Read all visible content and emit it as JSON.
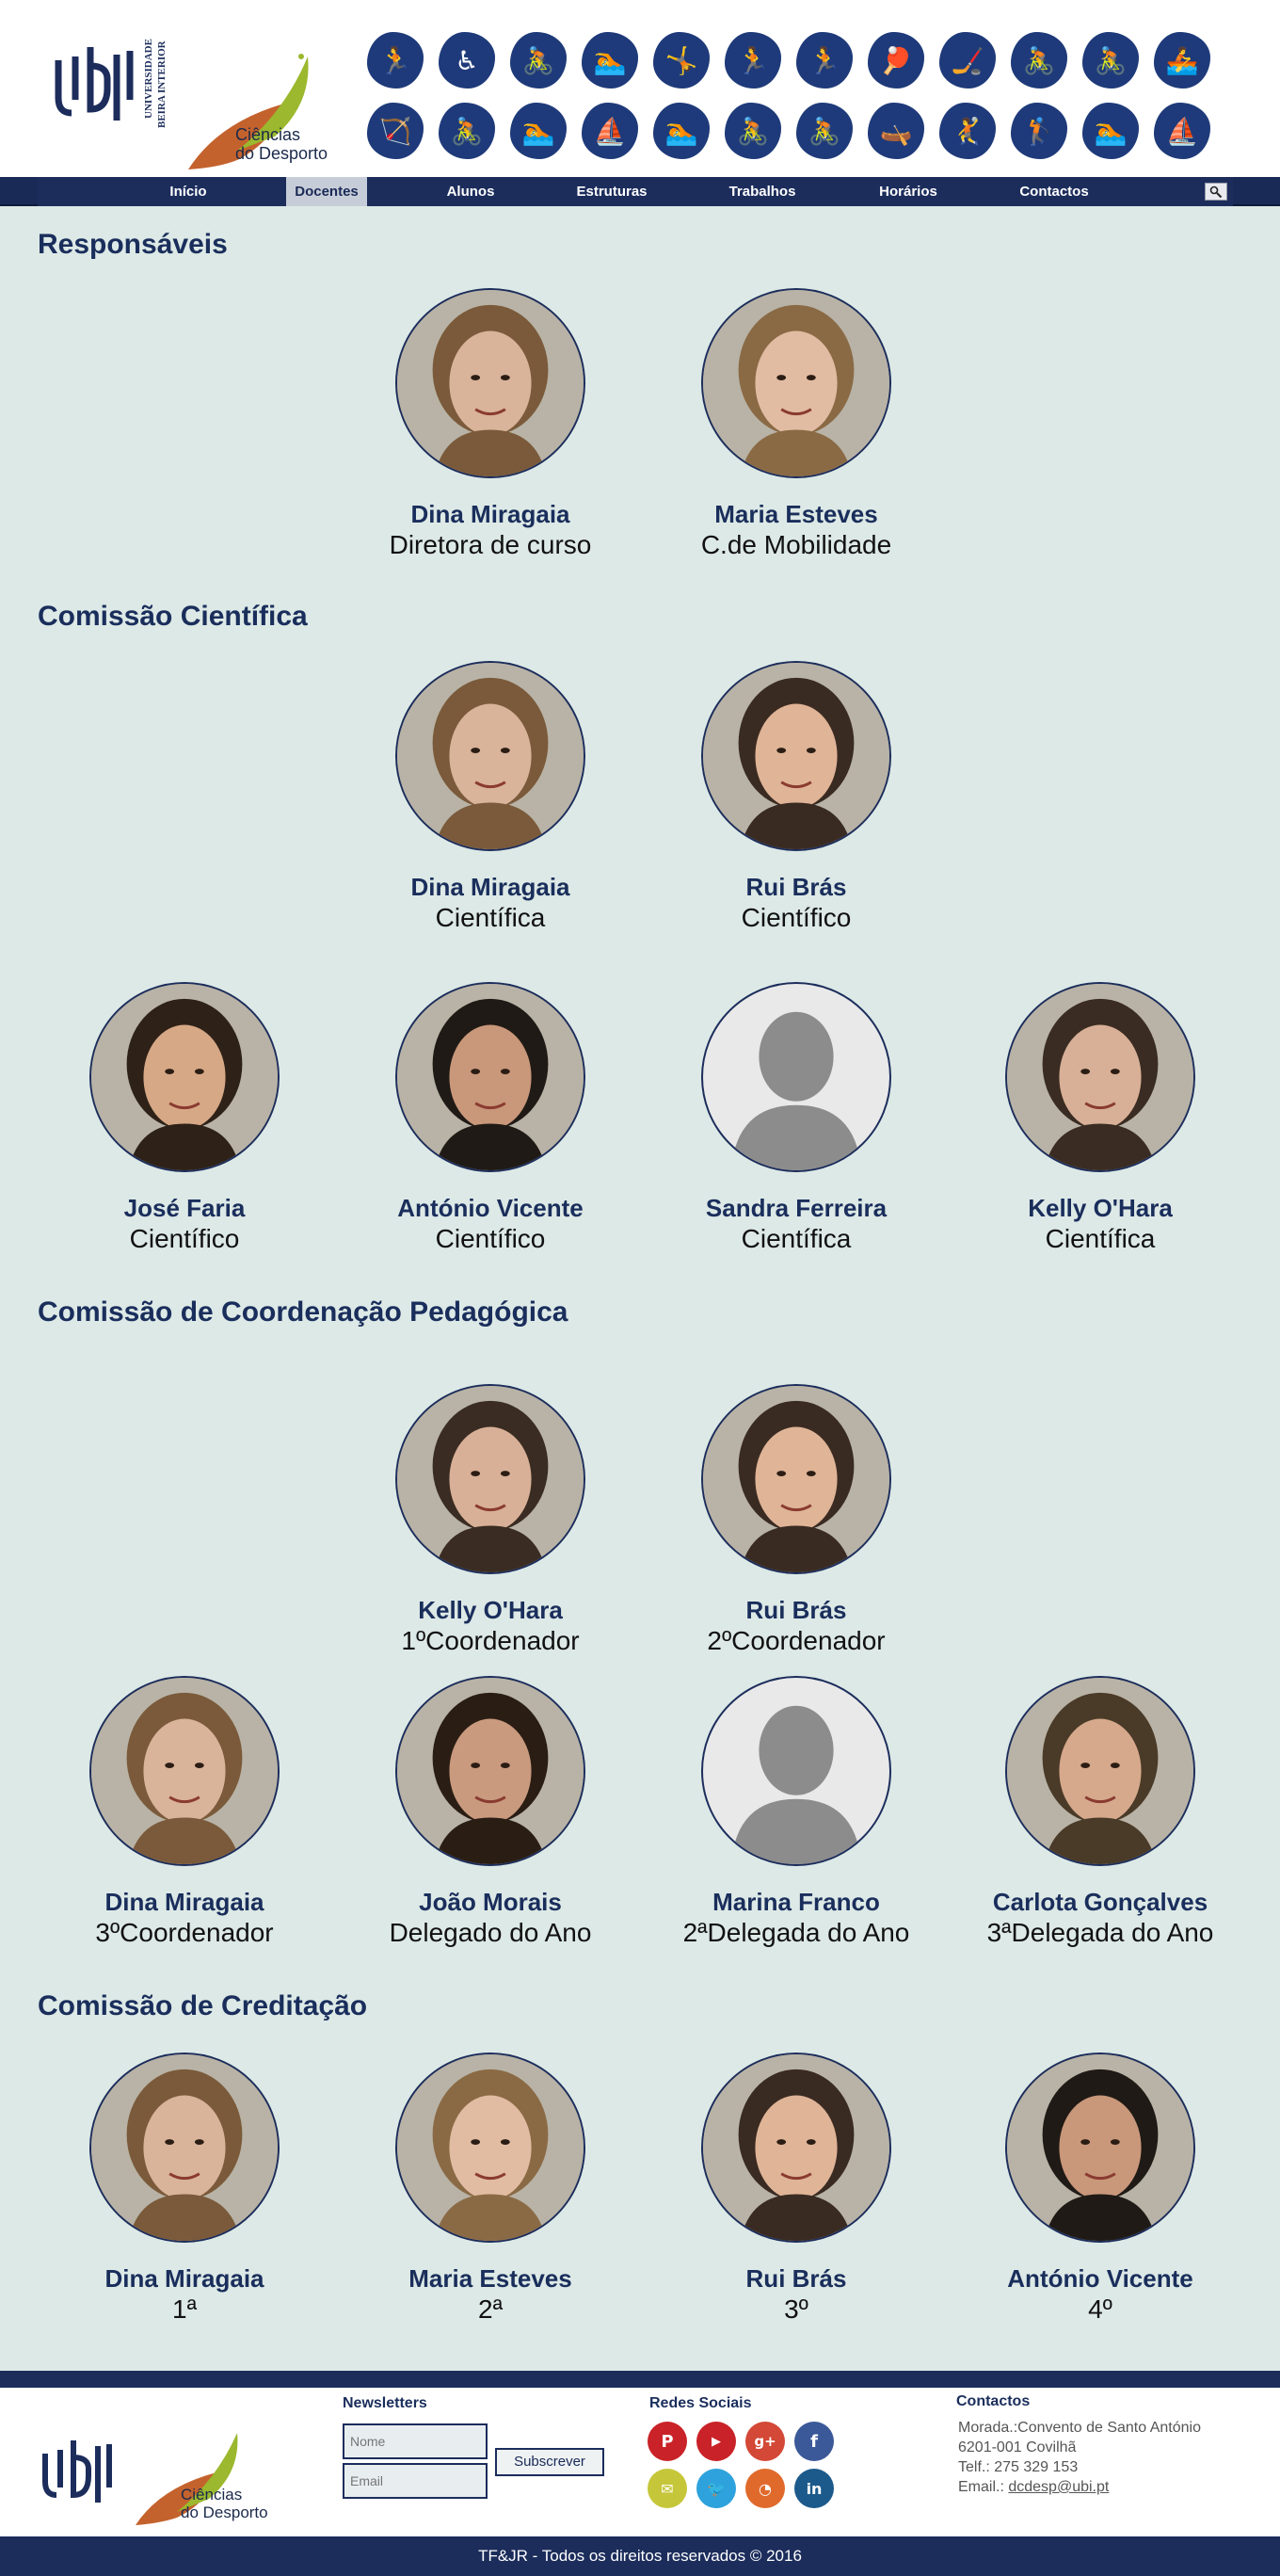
{
  "header": {
    "ubi_text_1": "UNIVERSIDADE",
    "ubi_text_2": "BEIRA INTERIOR",
    "dept_line1": "Ciências",
    "dept_line2": "do Desporto",
    "sport_icons": [
      "🏃",
      "♿",
      "🚴",
      "🏊",
      "🤸",
      "🏃",
      "🏃",
      "🏓",
      "🏒",
      "🚴",
      "🚴",
      "🚣",
      "🏹",
      "🚴",
      "🏊",
      "⛵",
      "🏊",
      "🚴",
      "🚴",
      "🛶",
      "🤾",
      "🏌",
      "🏊",
      "⛵"
    ]
  },
  "nav": {
    "items": [
      "Início",
      "Docentes",
      "Alunos",
      "Estruturas",
      "Trabalhos",
      "Horários",
      "Contactos"
    ],
    "active": "Docentes",
    "search_icon": "search-icon"
  },
  "sections": {
    "s1": "Responsáveis",
    "s2": "Comissão Científica",
    "s3": "Comissão de Coordenação Pedagógica",
    "s4": "Comissão de Creditação"
  },
  "people": {
    "r1": {
      "name": "Dina Miragaia",
      "role": "Diretora de curso"
    },
    "r2": {
      "name": "Maria Esteves",
      "role": "C.de Mobilidade"
    },
    "c1": {
      "name": "Dina Miragaia",
      "role": "Científica"
    },
    "c2": {
      "name": "Rui Brás",
      "role": "Científico"
    },
    "c3": {
      "name": "José Faria",
      "role": "Científico"
    },
    "c4": {
      "name": "António Vicente",
      "role": "Científico"
    },
    "c5": {
      "name": "Sandra Ferreira",
      "role": "Científica"
    },
    "c6": {
      "name": "Kelly O'Hara",
      "role": "Científica"
    },
    "p1": {
      "name": "Kelly O'Hara",
      "role": "1ºCoordenador"
    },
    "p2": {
      "name": "Rui Brás",
      "role": "2ºCoordenador"
    },
    "p3": {
      "name": "Dina Miragaia",
      "role": "3ºCoordenador"
    },
    "p4": {
      "name": "João Morais",
      "role": "Delegado do Ano"
    },
    "p5": {
      "name": "Marina Franco",
      "role": "2ªDelegada do Ano"
    },
    "p6": {
      "name": "Carlota Gonçalves",
      "role": "3ªDelegada do Ano"
    },
    "k1": {
      "name": "Dina Miragaia",
      "role": "1ª"
    },
    "k2": {
      "name": "Maria Esteves",
      "role": "2ª"
    },
    "k3": {
      "name": "Rui Brás",
      "role": "3º"
    },
    "k4": {
      "name": "António Vicente",
      "role": "4º"
    }
  },
  "footer": {
    "newsletter_title": "Newsletters",
    "name_placeholder": "Nome",
    "email_placeholder": "Email",
    "subscribe_label": "Subscrever",
    "social_title": "Redes Sociais",
    "social_icons": [
      "pinterest-icon",
      "youtube-icon",
      "google-plus-icon",
      "facebook-icon",
      "email-icon",
      "twitter-icon",
      "rss-icon",
      "linkedin-icon"
    ],
    "contacts_title": "Contactos",
    "address1": "Morada.:Convento de Santo António",
    "address2": "6201-001 Covilhã",
    "phone": "Telf.: 275 329 153",
    "email_label": "Email.:",
    "email": "dcdesp@ubi.pt",
    "copyright": "TF&JR - Todos os direitos reservados © 2016"
  },
  "colors": {
    "navy": "#1c2d5c",
    "background": "#dde9e6",
    "accent_green": "#9bb82e"
  }
}
